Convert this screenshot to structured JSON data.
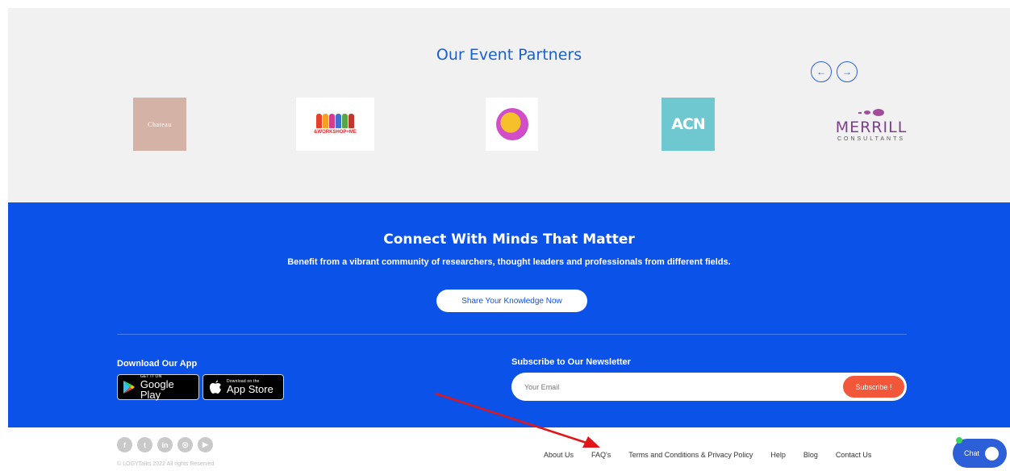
{
  "partners": {
    "title": "Our Event Partners",
    "prev_icon": "arrow-left-icon",
    "next_icon": "arrow-right-icon",
    "prev_glyph": "←",
    "next_glyph": "→",
    "logos": [
      {
        "name": "chateau",
        "text": "Chateau"
      },
      {
        "name": "workshop",
        "text": "&WORKSHOP+ME"
      },
      {
        "name": "circle",
        "text": ""
      },
      {
        "name": "acn",
        "text": "ACN"
      },
      {
        "name": "merrill",
        "text": "MERRILL",
        "sub": "CONSULTANTS"
      }
    ]
  },
  "cta": {
    "title": "Connect With Minds That Matter",
    "subtitle": "Benefit from a vibrant community of researchers, thought leaders and professionals from different fields.",
    "button": "Share Your Knowledge Now"
  },
  "app": {
    "label": "Download Our App",
    "google_small": "GET IT ON",
    "google_big": "Google Play",
    "apple_small": "Download on the",
    "apple_big": "App Store"
  },
  "newsletter": {
    "label": "Subscribe to Our Newsletter",
    "placeholder": "Your Email",
    "button": "Subscribe !"
  },
  "footer": {
    "social_icons": [
      "facebook-icon",
      "twitter-icon",
      "linkedin-icon",
      "instagram-icon",
      "youtube-icon"
    ],
    "social_glyphs": [
      "f",
      "t",
      "in",
      "◎",
      "▶"
    ],
    "copyright": "© LOGYTalks 2022 All rights Reserved",
    "links": {
      "about": "About Us",
      "faq": "FAQ's",
      "terms": "Terms and Conditions & Privacy Policy",
      "help": "Help",
      "blog": "Blog",
      "contact": "Contact Us"
    },
    "chat": "Chat"
  },
  "colors": {
    "brand_blue": "#0b52e8",
    "accent_orange": "#f2573a",
    "annotation_red": "#e0161b"
  }
}
